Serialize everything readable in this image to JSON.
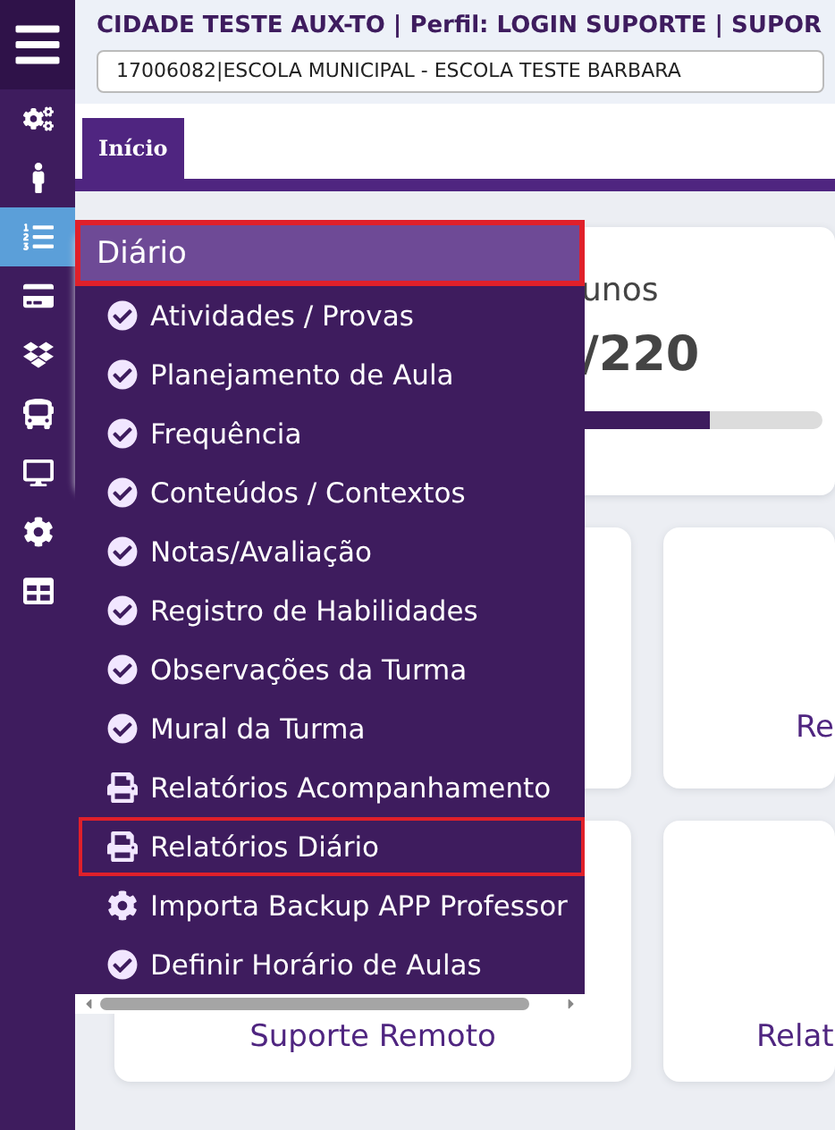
{
  "header": {
    "title": "CIDADE TESTE AUX-TO | Perfil: LOGIN SUPORTE | SUPOR",
    "school_select": {
      "value": "17006082|ESCOLA MUNICIPAL - ESCOLA TESTE BARBARA"
    }
  },
  "sidebar": {
    "items": [
      {
        "selected": false
      },
      {
        "selected": false
      },
      {
        "selected": true
      },
      {
        "selected": false
      },
      {
        "selected": false
      },
      {
        "selected": false
      },
      {
        "selected": false
      },
      {
        "selected": false
      },
      {
        "selected": false
      }
    ]
  },
  "tabs": [
    {
      "label": "Início",
      "selected": true
    }
  ],
  "summary_card": {
    "label": "unos",
    "value": "/220",
    "level": 0.84
  },
  "cards": [
    {
      "label": "Re"
    },
    {
      "label": "Suporte Remoto"
    },
    {
      "label": "Relat"
    }
  ],
  "menu": {
    "title": "Diário",
    "highlighted": true,
    "items": [
      {
        "label": "Atividades / Provas",
        "kind": "check",
        "highlighted": false
      },
      {
        "label": "Planejamento de Aula",
        "kind": "check",
        "highlighted": false
      },
      {
        "label": "Frequência",
        "kind": "check",
        "highlighted": false
      },
      {
        "label": "Conteúdos / Contextos",
        "kind": "check",
        "highlighted": false
      },
      {
        "label": "Notas/Avaliação",
        "kind": "check",
        "highlighted": false
      },
      {
        "label": "Registro de Habilidades",
        "kind": "check",
        "highlighted": false
      },
      {
        "label": "Observações da Turma",
        "kind": "check",
        "highlighted": false
      },
      {
        "label": "Mural da Turma",
        "kind": "check",
        "highlighted": false
      },
      {
        "label": "Relatórios Acompanhamento",
        "kind": "report",
        "highlighted": false
      },
      {
        "label": "Relatórios Diário",
        "kind": "report",
        "highlighted": true
      },
      {
        "label": "Importa Backup APP Professor",
        "kind": "tool",
        "highlighted": false
      },
      {
        "label": "Definir Horário de Aulas",
        "kind": "check",
        "highlighted": false
      }
    ]
  }
}
